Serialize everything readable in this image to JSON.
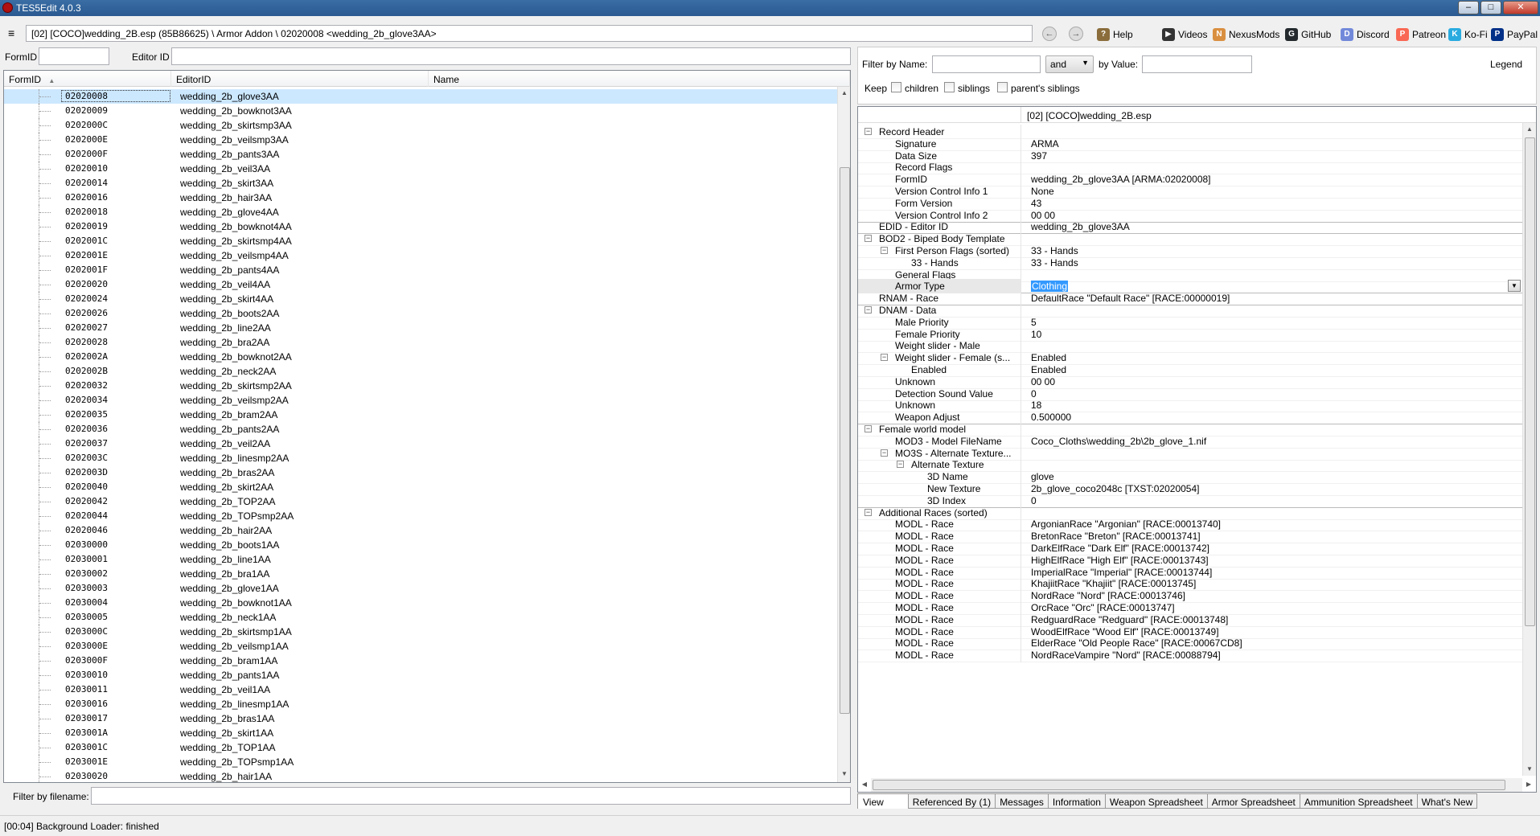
{
  "window": {
    "title": "TES5Edit 4.0.3",
    "min_label": "–",
    "max_label": "□",
    "close_label": "✕"
  },
  "pathbar": {
    "path": "[02] [COCO]wedding_2B.esp (85B86625) \\ Armor Addon \\ 02020008 <wedding_2b_glove3AA>",
    "back_icon": "←",
    "forward_icon": "→",
    "menu_icon": "≡"
  },
  "toplinks": [
    {
      "label": "Help",
      "icon": "book-icon",
      "glyph": "?",
      "color": "#8a6d3b"
    },
    {
      "label": "Videos",
      "icon": "video-icon",
      "glyph": "▶",
      "color": "#333333"
    },
    {
      "label": "NexusMods",
      "icon": "nexusmods-icon",
      "glyph": "N",
      "color": "#d98f40"
    },
    {
      "label": "GitHub",
      "icon": "github-icon",
      "glyph": "G",
      "color": "#24292e"
    },
    {
      "label": "Discord",
      "icon": "discord-icon",
      "glyph": "D",
      "color": "#7289da"
    },
    {
      "label": "Patreon",
      "icon": "patreon-icon",
      "glyph": "P",
      "color": "#f96854"
    },
    {
      "label": "Ko-Fi",
      "icon": "kofi-icon",
      "glyph": "K",
      "color": "#29abe0"
    },
    {
      "label": "PayPal",
      "icon": "paypal-icon",
      "glyph": "P",
      "color": "#003087"
    }
  ],
  "left": {
    "formid_label": "FormID",
    "editorid_label": "Editor ID",
    "columns": [
      "FormID",
      "EditorID",
      "Name"
    ],
    "sort_icon": "▲",
    "rows": [
      {
        "formid": "02020008",
        "editorid": "wedding_2b_glove3AA"
      },
      {
        "formid": "02020009",
        "editorid": "wedding_2b_bowknot3AA"
      },
      {
        "formid": "0202000C",
        "editorid": "wedding_2b_skirtsmp3AA"
      },
      {
        "formid": "0202000E",
        "editorid": "wedding_2b_veilsmp3AA"
      },
      {
        "formid": "0202000F",
        "editorid": "wedding_2b_pants3AA"
      },
      {
        "formid": "02020010",
        "editorid": "wedding_2b_veil3AA"
      },
      {
        "formid": "02020014",
        "editorid": "wedding_2b_skirt3AA"
      },
      {
        "formid": "02020016",
        "editorid": "wedding_2b_hair3AA"
      },
      {
        "formid": "02020018",
        "editorid": "wedding_2b_glove4AA"
      },
      {
        "formid": "02020019",
        "editorid": "wedding_2b_bowknot4AA"
      },
      {
        "formid": "0202001C",
        "editorid": "wedding_2b_skirtsmp4AA"
      },
      {
        "formid": "0202001E",
        "editorid": "wedding_2b_veilsmp4AA"
      },
      {
        "formid": "0202001F",
        "editorid": "wedding_2b_pants4AA"
      },
      {
        "formid": "02020020",
        "editorid": "wedding_2b_veil4AA"
      },
      {
        "formid": "02020024",
        "editorid": "wedding_2b_skirt4AA"
      },
      {
        "formid": "02020026",
        "editorid": "wedding_2b_boots2AA"
      },
      {
        "formid": "02020027",
        "editorid": "wedding_2b_line2AA"
      },
      {
        "formid": "02020028",
        "editorid": "wedding_2b_bra2AA"
      },
      {
        "formid": "0202002A",
        "editorid": "wedding_2b_bowknot2AA"
      },
      {
        "formid": "0202002B",
        "editorid": "wedding_2b_neck2AA"
      },
      {
        "formid": "02020032",
        "editorid": "wedding_2b_skirtsmp2AA"
      },
      {
        "formid": "02020034",
        "editorid": "wedding_2b_veilsmp2AA"
      },
      {
        "formid": "02020035",
        "editorid": "wedding_2b_bram2AA"
      },
      {
        "formid": "02020036",
        "editorid": "wedding_2b_pants2AA"
      },
      {
        "formid": "02020037",
        "editorid": "wedding_2b_veil2AA"
      },
      {
        "formid": "0202003C",
        "editorid": "wedding_2b_linesmp2AA"
      },
      {
        "formid": "0202003D",
        "editorid": "wedding_2b_bras2AA"
      },
      {
        "formid": "02020040",
        "editorid": "wedding_2b_skirt2AA"
      },
      {
        "formid": "02020042",
        "editorid": "wedding_2b_TOP2AA"
      },
      {
        "formid": "02020044",
        "editorid": "wedding_2b_TOPsmp2AA"
      },
      {
        "formid": "02020046",
        "editorid": "wedding_2b_hair2AA"
      },
      {
        "formid": "02030000",
        "editorid": "wedding_2b_boots1AA"
      },
      {
        "formid": "02030001",
        "editorid": "wedding_2b_line1AA"
      },
      {
        "formid": "02030002",
        "editorid": "wedding_2b_bra1AA"
      },
      {
        "formid": "02030003",
        "editorid": "wedding_2b_glove1AA"
      },
      {
        "formid": "02030004",
        "editorid": "wedding_2b_bowknot1AA"
      },
      {
        "formid": "02030005",
        "editorid": "wedding_2b_neck1AA"
      },
      {
        "formid": "0203000C",
        "editorid": "wedding_2b_skirtsmp1AA"
      },
      {
        "formid": "0203000E",
        "editorid": "wedding_2b_veilsmp1AA"
      },
      {
        "formid": "0203000F",
        "editorid": "wedding_2b_bram1AA"
      },
      {
        "formid": "02030010",
        "editorid": "wedding_2b_pants1AA"
      },
      {
        "formid": "02030011",
        "editorid": "wedding_2b_veil1AA"
      },
      {
        "formid": "02030016",
        "editorid": "wedding_2b_linesmp1AA"
      },
      {
        "formid": "02030017",
        "editorid": "wedding_2b_bras1AA"
      },
      {
        "formid": "0203001A",
        "editorid": "wedding_2b_skirt1AA"
      },
      {
        "formid": "0203001C",
        "editorid": "wedding_2b_TOP1AA"
      },
      {
        "formid": "0203001E",
        "editorid": "wedding_2b_TOPsmp1AA"
      },
      {
        "formid": "02030020",
        "editorid": "wedding_2b_hair1AA"
      }
    ],
    "filename_label": "Filter by filename:"
  },
  "right": {
    "filter_name_label": "Filter by Name:",
    "operator": "and",
    "by_value_label": "by Value:",
    "legend_label": "Legend",
    "keep_label": "Keep",
    "keep_children": "children",
    "keep_siblings": "siblings",
    "keep_parent_siblings": "parent's siblings",
    "plugin_header": "[02] [COCO]wedding_2B.esp",
    "rows": [
      {
        "name": "Record Header",
        "value": "",
        "indent": 0,
        "exp": "-"
      },
      {
        "name": "Signature",
        "value": "ARMA",
        "indent": 1
      },
      {
        "name": "Data Size",
        "value": "397",
        "indent": 1
      },
      {
        "name": "Record Flags",
        "value": "",
        "indent": 1
      },
      {
        "name": "FormID",
        "value": "wedding_2b_glove3AA [ARMA:02020008]",
        "indent": 1
      },
      {
        "name": "Version Control Info 1",
        "value": "None",
        "indent": 1
      },
      {
        "name": "Form Version",
        "value": "43",
        "indent": 1
      },
      {
        "name": "Version Control Info 2",
        "value": "00 00",
        "indent": 1,
        "sep": true
      },
      {
        "name": "EDID - Editor ID",
        "value": "wedding_2b_glove3AA",
        "indent": 0,
        "sep": true
      },
      {
        "name": "BOD2 - Biped Body Template",
        "value": "",
        "indent": 0,
        "exp": "-"
      },
      {
        "name": "First Person Flags (sorted)",
        "value": "33 - Hands",
        "indent": 1,
        "exp": "-"
      },
      {
        "name": "33 - Hands",
        "value": "33 - Hands",
        "indent": 2
      },
      {
        "name": "General Flags",
        "value": "",
        "indent": 1
      },
      {
        "name": "Armor Type",
        "value": "Clothing",
        "indent": 1,
        "selected": true,
        "sep": true
      },
      {
        "name": "RNAM - Race",
        "value": "DefaultRace \"Default Race\" [RACE:00000019]",
        "indent": 0,
        "sep": true
      },
      {
        "name": "DNAM - Data",
        "value": "",
        "indent": 0,
        "exp": "-"
      },
      {
        "name": "Male Priority",
        "value": "5",
        "indent": 1
      },
      {
        "name": "Female Priority",
        "value": "10",
        "indent": 1
      },
      {
        "name": "Weight slider - Male",
        "value": "",
        "indent": 1
      },
      {
        "name": "Weight slider - Female (s...",
        "value": "Enabled",
        "indent": 1,
        "exp": "-"
      },
      {
        "name": "Enabled",
        "value": "Enabled",
        "indent": 2
      },
      {
        "name": "Unknown",
        "value": "00 00",
        "indent": 1
      },
      {
        "name": "Detection Sound Value",
        "value": "0",
        "indent": 1
      },
      {
        "name": "Unknown",
        "value": "18",
        "indent": 1
      },
      {
        "name": "Weapon Adjust",
        "value": "0.500000",
        "indent": 1,
        "sep": true
      },
      {
        "name": "Female world model",
        "value": "",
        "indent": 0,
        "exp": "-"
      },
      {
        "name": "MOD3 - Model FileName",
        "value": "Coco_Cloths\\wedding_2b\\2b_glove_1.nif",
        "indent": 1
      },
      {
        "name": "MO3S - Alternate Texture...",
        "value": "",
        "indent": 1,
        "exp": "-"
      },
      {
        "name": "Alternate Texture",
        "value": "",
        "indent": 2,
        "exp": "-"
      },
      {
        "name": "3D Name",
        "value": "glove",
        "indent": 3
      },
      {
        "name": "New Texture",
        "value": "2b_glove_coco2048c [TXST:02020054]",
        "indent": 3
      },
      {
        "name": "3D Index",
        "value": "0",
        "indent": 3,
        "sep": true
      },
      {
        "name": "Additional Races (sorted)",
        "value": "",
        "indent": 0,
        "exp": "-"
      },
      {
        "name": "MODL - Race",
        "value": "ArgonianRace \"Argonian\" [RACE:00013740]",
        "indent": 1
      },
      {
        "name": "MODL - Race",
        "value": "BretonRace \"Breton\" [RACE:00013741]",
        "indent": 1
      },
      {
        "name": "MODL - Race",
        "value": "DarkElfRace \"Dark Elf\" [RACE:00013742]",
        "indent": 1
      },
      {
        "name": "MODL - Race",
        "value": "HighElfRace \"High Elf\" [RACE:00013743]",
        "indent": 1
      },
      {
        "name": "MODL - Race",
        "value": "ImperialRace \"Imperial\" [RACE:00013744]",
        "indent": 1
      },
      {
        "name": "MODL - Race",
        "value": "KhajiitRace \"Khajiit\" [RACE:00013745]",
        "indent": 1
      },
      {
        "name": "MODL - Race",
        "value": "NordRace \"Nord\" [RACE:00013746]",
        "indent": 1
      },
      {
        "name": "MODL - Race",
        "value": "OrcRace \"Orc\" [RACE:00013747]",
        "indent": 1
      },
      {
        "name": "MODL - Race",
        "value": "RedguardRace \"Redguard\" [RACE:00013748]",
        "indent": 1
      },
      {
        "name": "MODL - Race",
        "value": "WoodElfRace \"Wood Elf\" [RACE:00013749]",
        "indent": 1
      },
      {
        "name": "MODL - Race",
        "value": "ElderRace \"Old People Race\" [RACE:00067CD8]",
        "indent": 1
      },
      {
        "name": "MODL - Race",
        "value": "NordRaceVampire \"Nord\" [RACE:00088794]",
        "indent": 1
      }
    ],
    "tabs": [
      "View",
      "Referenced By (1)",
      "Messages",
      "Information",
      "Weapon Spreadsheet",
      "Armor Spreadsheet",
      "Ammunition Spreadsheet",
      "What's New"
    ],
    "active_tab": "View"
  },
  "status": {
    "text": "[00:04] Background Loader: finished"
  },
  "colors": {
    "titlebar": "#2a5a90",
    "selection": "#cce8ff",
    "value_highlight": "#3399ff"
  }
}
